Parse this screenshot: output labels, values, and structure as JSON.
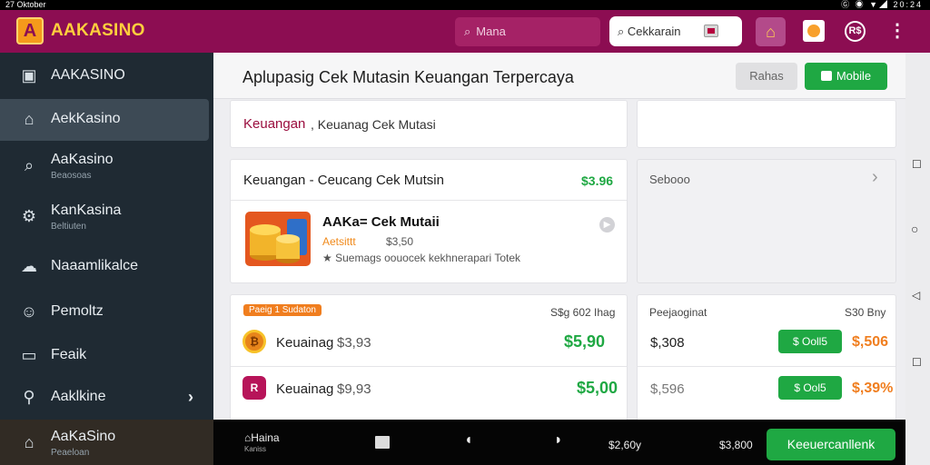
{
  "status_bar": {
    "time": "27 Oktober",
    "right": "Ⓖ ◉ ▼◢ 20:24"
  },
  "header": {
    "logo_letter": "A",
    "app_name": "AAKASINO",
    "search_placeholder": "Mana",
    "check_button": "Cekkarain",
    "help_label": "R$"
  },
  "sidebar": {
    "items": [
      {
        "label": "AAKASINO",
        "sub": ""
      },
      {
        "label": "AekKasino",
        "sub": ""
      },
      {
        "label": "AaKasino",
        "sub": "Beaosoas"
      },
      {
        "label": "KanKasina",
        "sub": "Beltiuten"
      },
      {
        "label": "Naaamlikalce",
        "sub": ""
      },
      {
        "label": "Pemoltz",
        "sub": ""
      },
      {
        "label": "Feaik",
        "sub": ""
      },
      {
        "label": "Aaklkine",
        "sub": ""
      },
      {
        "label": "AaKaSino",
        "sub": "Peaeloan"
      }
    ]
  },
  "main": {
    "title": "Aplupasig Cek Mutasin Keuangan Terpercaya",
    "btn_secondary": "Rahas",
    "btn_primary": "Mobile",
    "card1": {
      "accent": "Keuangan",
      "text": ", Keuanag Cek Mutasi"
    },
    "card2": {
      "header": "Keuangan - Ceucang Cek Mutsin",
      "header_amount": "$3.96",
      "product_title": "AAKa= Cek Mutaii",
      "rating": "Aetsittt",
      "price": "$3,50",
      "desc": "★ Suemags oouocek kekhnerapari Totek"
    },
    "side_card": {
      "label": "Sebooo"
    },
    "list_left": {
      "badge": "Paeig 1 Sudaton",
      "header_right": "S$g 602 Ihag",
      "rows": [
        {
          "label": "Keuainag",
          "value": "$3,93",
          "amount": "$5,90"
        },
        {
          "label": "Keuainag",
          "value": "$9,93",
          "amount": "$5,00"
        }
      ]
    },
    "list_right": {
      "header_left": "Peejaoginat",
      "header_right": "S30 Bny",
      "rows": [
        {
          "left": "$,308",
          "pill": "$ Ooll5",
          "amount": "$,506"
        },
        {
          "left": "$,596",
          "pill": "$ Ool5",
          "amount": "$,39%"
        }
      ]
    }
  },
  "bottom_nav": {
    "home_label": "Haina",
    "home_sub": "Kaniss",
    "balance1": "$2,60y",
    "balance2": "$3,800",
    "cta": "Keeuercanllenk"
  },
  "colors": {
    "brand": "#8c0d52",
    "accent_gold": "#ffcf3d",
    "positive": "#1fa843",
    "orange": "#f07e1f"
  }
}
